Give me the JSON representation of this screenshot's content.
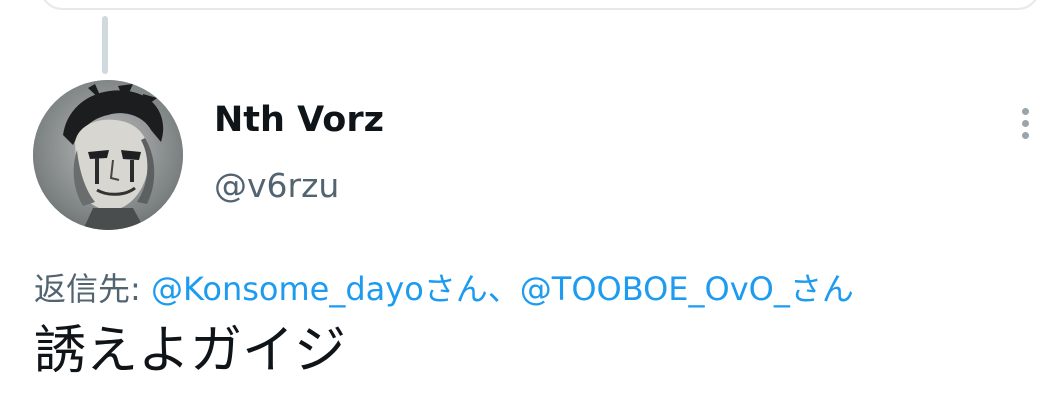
{
  "colors": {
    "text_primary": "#0f1419",
    "text_secondary": "#536471",
    "link": "#1d9bf0",
    "thread_line": "#cfd9de"
  },
  "author": {
    "display_name": "Nth Vorz",
    "handle": "@v6rzu",
    "avatar_icon": "manga-face-avatar"
  },
  "menu": {
    "icon": "more-vertical-icon"
  },
  "reply": {
    "prefix": "返信先: ",
    "mention_1": "@Konsome_dayo",
    "suffix_1": "さん、",
    "mention_2": "@TOOBOE_OvO_",
    "suffix_2": "さん"
  },
  "tweet": {
    "text": "誘えよガイジ"
  }
}
